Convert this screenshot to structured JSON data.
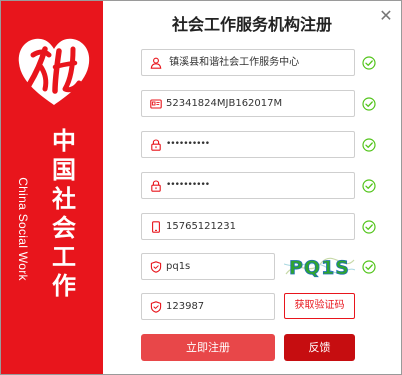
{
  "window": {
    "title": "社会工作服务机构注册",
    "close_glyph": "✕"
  },
  "brand": {
    "chinese_name": "中国社会工作",
    "english_name": "China Social Work",
    "logo_icon": "social-work-logo",
    "color": "#e8151c"
  },
  "form": {
    "fields": [
      {
        "name": "organization-name",
        "icon": "user-icon",
        "value": " 镇溪县和谐社会工作服务中心",
        "valid": true
      },
      {
        "name": "credit-code",
        "icon": "id-card-icon",
        "value": "52341824MJB162017M",
        "valid": true
      },
      {
        "name": "password",
        "icon": "lock-icon",
        "value": "••••••••••",
        "valid": true
      },
      {
        "name": "confirm-password",
        "icon": "lock-icon",
        "value": "••••••••••",
        "valid": true
      },
      {
        "name": "phone",
        "icon": "phone-icon",
        "value": "15765121231",
        "valid": true
      },
      {
        "name": "captcha",
        "icon": "shield-icon",
        "value": "pq1s",
        "valid": true
      },
      {
        "name": "sms-code",
        "icon": "shield-icon",
        "value": "123987",
        "valid": false
      }
    ],
    "captcha_text": "PQ1S",
    "valid_color": "#52c41a"
  },
  "buttons": {
    "get_code": "获取验证码",
    "register": "立即注册",
    "feedback": "反馈"
  }
}
